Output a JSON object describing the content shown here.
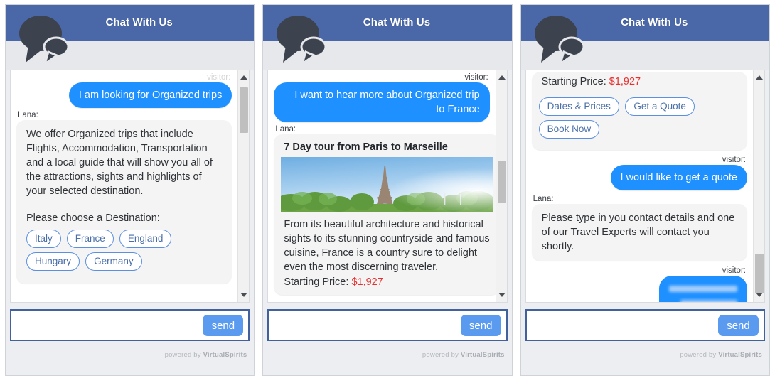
{
  "widget": {
    "title": "Chat With Us",
    "avatar_icon": "chat-bubbles-icon",
    "send_label": "send",
    "input_placeholder": "",
    "input_value": "",
    "powered_prefix": "powered by",
    "powered_brand": "VirtualSpirits",
    "accent_header": "#4a68a8",
    "accent_visitor_bubble": "#1e90ff",
    "accent_price": "#e8312f",
    "accent_chip_border": "#5b8fe0",
    "accent_send": "#5a9bf0"
  },
  "labels": {
    "visitor": "visitor:",
    "agent": "Lana:"
  },
  "panels": [
    {
      "id": "panel-1",
      "scroll_position": "top",
      "messages": [
        {
          "type": "visitor",
          "sender": "visitor:",
          "text": "I am looking for Organized trips"
        },
        {
          "type": "agent",
          "sender": "Lana:",
          "text": "We offer Organized trips that include Flights, Accommodation, Transportation and a local guide that will show you all of the attractions, sights and highlights of your selected destination.",
          "prompt": "Please choose a Destination:",
          "options": [
            "Italy",
            "France",
            "England",
            "Hungary",
            "Germany"
          ]
        }
      ]
    },
    {
      "id": "panel-2",
      "scroll_position": "middle",
      "messages": [
        {
          "type": "visitor",
          "sender": "visitor:",
          "text": "I want to hear more about Organized trip to France"
        },
        {
          "type": "agent-card",
          "sender": "Lana:",
          "card_title": "7 Day tour from Paris to Marseille",
          "card_image": "eiffel-tower-photo",
          "card_text": "From its beautiful architecture and historical sights to its stunning countryside and famous cuisine, France is a country sure to delight even the most discerning traveler.",
          "price_label": "Starting Price:",
          "price_value": "$1,927"
        }
      ]
    },
    {
      "id": "panel-3",
      "scroll_position": "bottom",
      "messages": [
        {
          "type": "agent-card-tail",
          "price_label": "Starting Price:",
          "price_value": "$1,927",
          "options": [
            "Dates & Prices",
            "Get a Quote",
            "Book Now"
          ]
        },
        {
          "type": "visitor",
          "sender": "visitor:",
          "text": "I would like to get a quote"
        },
        {
          "type": "agent",
          "sender": "Lana:",
          "text": "Please type in you contact details and one of our Travel Experts will contact you shortly."
        },
        {
          "type": "visitor-redacted",
          "sender": "visitor:",
          "text": ""
        }
      ]
    }
  ]
}
